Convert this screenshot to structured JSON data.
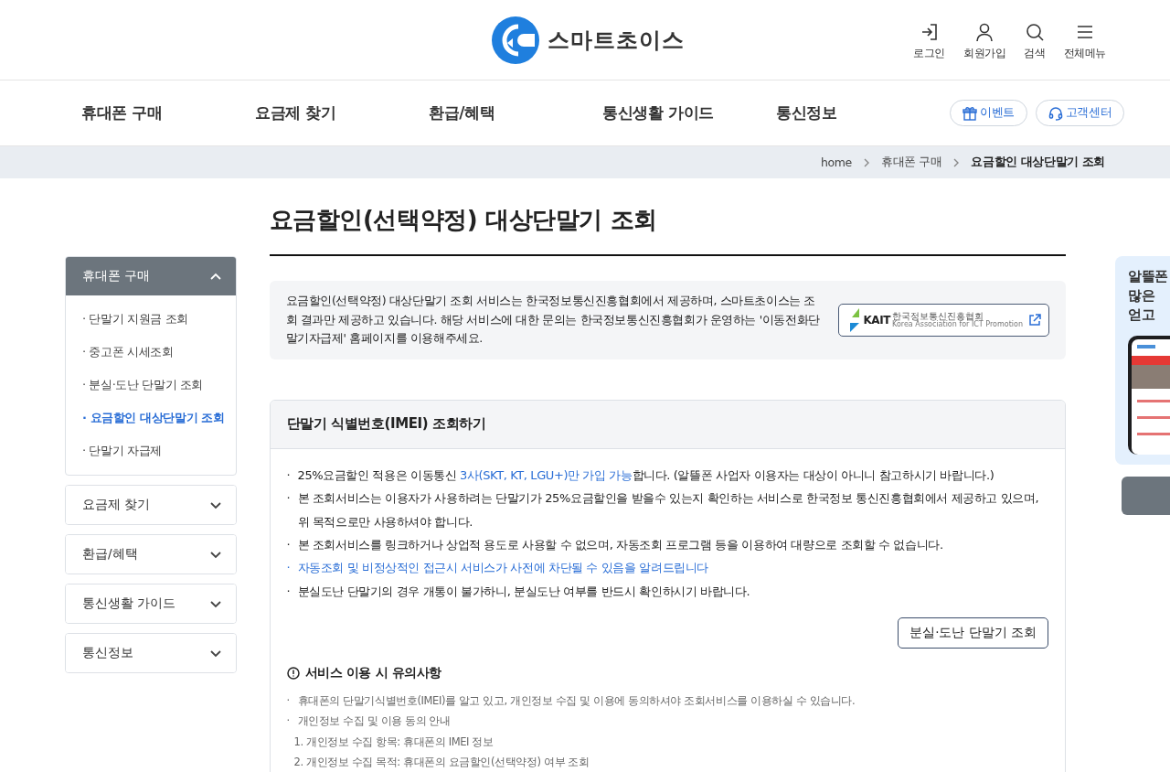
{
  "header": {
    "logo": "스마트초이스",
    "utilities": [
      {
        "label": "로그인"
      },
      {
        "label": "회원가입"
      },
      {
        "label": "검색"
      },
      {
        "label": "전체메뉴"
      }
    ]
  },
  "nav": {
    "items": [
      "휴대폰 구매",
      "요금제 찾기",
      "환급/혜택",
      "통신생활 가이드",
      "통신정보"
    ],
    "buttons": [
      {
        "label": "이벤트"
      },
      {
        "label": "고객센터"
      }
    ]
  },
  "breadcrumb": [
    "home",
    "휴대폰 구매",
    "요금할인 대상단말기 조회"
  ],
  "page_title": "요금할인(선택약정) 대상단말기 조회",
  "sidebar": [
    {
      "label": "휴대폰 구매",
      "expanded": true,
      "children": [
        {
          "label": "· 단말기 지원금 조회",
          "selected": false
        },
        {
          "label": "· 중고폰 시세조회",
          "selected": false
        },
        {
          "label": "· 분실·도난 단말기 조회",
          "selected": false
        },
        {
          "label": "· 요금할인 대상단말기 조회",
          "selected": true
        },
        {
          "label": "· 단말기 자급제",
          "selected": false
        }
      ]
    },
    {
      "label": "요금제 찾기",
      "expanded": false
    },
    {
      "label": "환급/혜택",
      "expanded": false
    },
    {
      "label": "통신생활 가이드",
      "expanded": false
    },
    {
      "label": "통신정보",
      "expanded": false
    }
  ],
  "intro": {
    "text": "요금할인(선택약정) 대상단말기 조회 서비스는 한국정보통신진흥협회에서 제공하며, 스마트초이스는 조회 결과만 제공하고 있습니다. 해당 서비스에 대한 문의는 한국정보통신진흥협회가 운영하는 '이동전화단말기자급제' 홈페이지를 이용해주세요.",
    "partner": {
      "abbr": "KAIT",
      "name": "한국정보통신진흥협회",
      "english": "Korea Association for ICT Promotion"
    }
  },
  "panel": {
    "title": "단말기 식별번호(IMEI) 조회하기",
    "bullets": [
      {
        "marker": "·",
        "segments": [
          {
            "text": "25%요금할인 적용은 이동통신 ",
            "highlight": false
          },
          {
            "text": "3사(SKT, KT, LGU+)만 가입 가능",
            "highlight": true
          },
          {
            "text": "합니다. (알뜰폰 사업자 이용자는 대상이 아니니 참고하시기 바랍니다.)",
            "highlight": false
          }
        ]
      },
      {
        "marker": "·",
        "segments": [
          {
            "text": "본 조회서비스는 이용자가 사용하려는 단말기가 25%요금할인을 받을수 있는지 확인하는 서비스로 한국정보 통신진흥협회에서 제공하고 있으며, 위 목적으로만 사용하셔야 합니다.",
            "highlight": false
          }
        ]
      },
      {
        "marker": "·",
        "segments": [
          {
            "text": "본 조회서비스를 링크하거나 상업적 용도로 사용할 수 없으며, 자동조회 프로그램 등을 이용하여 대량으로 조회할 수 없습니다.",
            "highlight": false
          }
        ]
      },
      {
        "marker": "·",
        "segments": [
          {
            "text": "자동조회 및 비정상적인 접근시 서비스가 사전에 차단될 수 있음을 알려드립니다",
            "highlight": true
          }
        ]
      },
      {
        "marker": "·",
        "segments": [
          {
            "text": "분실도난 단말기의 경우 개통이 불가하니, 분실도난 여부를 반드시 확인하시기 바랍니다.",
            "highlight": false
          }
        ]
      }
    ],
    "button": "분실·도난 단말기 조회",
    "notice_title": "서비스 이용 시 유의사항",
    "notes": [
      {
        "kind": "bullet",
        "marker": "·",
        "text": "휴대폰의 단말기식별번호(IMEI)를 알고 있고, 개인정보 수집 및 이용에 동의하셔야 조회서비스를 이용하실 수 있습니다."
      },
      {
        "kind": "bullet",
        "marker": "·",
        "text": "개인정보 수집 및 이용 동의 안내"
      },
      {
        "kind": "numbered",
        "text": "1. 개인정보 수집 항목: 휴대폰의 IMEI 정보"
      },
      {
        "kind": "numbered",
        "text": "2. 개인정보 수집 목적: 휴대폰의 요금할인(선택약정) 여부 조회"
      }
    ]
  },
  "banner": {
    "lines": [
      "알뜰폰",
      "많은",
      "얻고"
    ]
  }
}
